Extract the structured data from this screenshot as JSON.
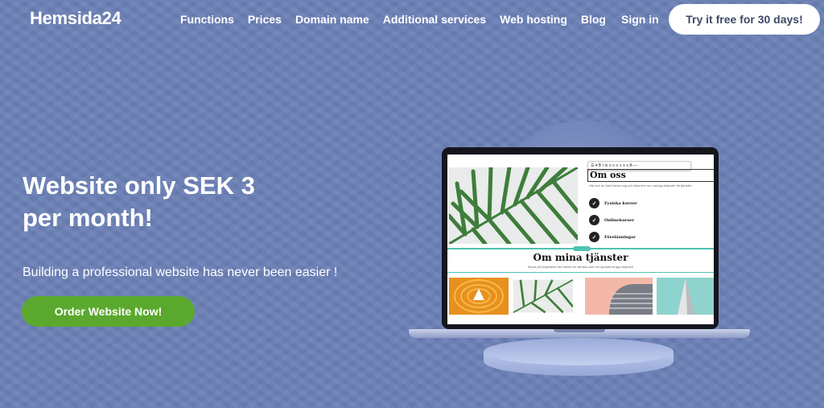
{
  "header": {
    "logo": "Hemsida24",
    "nav": [
      "Functions",
      "Prices",
      "Domain name",
      "Additional services",
      "Web hosting",
      "Blog"
    ],
    "sign_in": "Sign in",
    "cta": "Try it free for 30 days!"
  },
  "hero": {
    "title_line1": "Website only SEK 3",
    "title_line2": "per month!",
    "subtitle": "Building a professional website has never been easier !",
    "button": "Order Website Now!"
  },
  "mockup": {
    "heading": "Om oss",
    "description": "Här kan du lära känna mig och läsa mer om vad jag erbjuder för tjänster",
    "bullets": [
      "Fysiska kurser",
      "Onlinekurser",
      "Föreläsningar"
    ],
    "section_title": "Om mina tjänster",
    "section_desc": "Klicka på respektive bild nedan för att läsa mer om tjänsterna jag erbjuder!",
    "toolbar_icons": "☰ ▾ B I ⊘ ≡ ≡ ≡ ≡ ≡ ≡ A —"
  },
  "colors": {
    "background": "#6b80b6",
    "cta_green": "#5aa92e",
    "accent_teal": "#4fc3b3"
  }
}
